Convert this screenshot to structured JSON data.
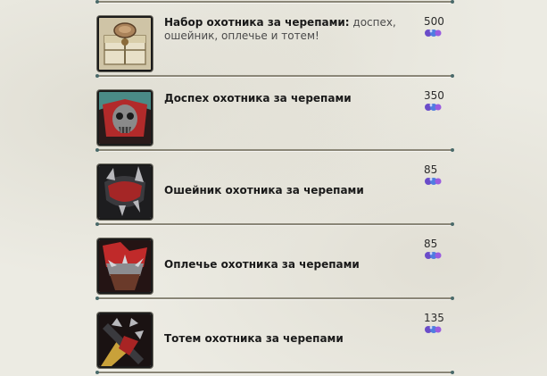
{
  "items": [
    {
      "name": "Набор охотника за черепами:",
      "desc": " доспех, ошейник, оплечье и тотем!",
      "price": "500",
      "icon": "supply-crate-icon"
    },
    {
      "name": "Доспех охотника за черепами",
      "desc": "",
      "price": "350",
      "icon": "skull-armor-icon"
    },
    {
      "name": "Ошейник охотника за черепами",
      "desc": "",
      "price": "85",
      "icon": "spiked-collar-icon"
    },
    {
      "name": "Оплечье охотника за черепами",
      "desc": "",
      "price": "85",
      "icon": "shoulder-armor-icon"
    },
    {
      "name": "Тотем охотника за черепами",
      "desc": "",
      "price": "135",
      "icon": "skull-totem-icon"
    }
  ],
  "currency_icon": "gem-cluster-icon",
  "colors": {
    "divider": "#8a8677",
    "text": "#1a1a1a",
    "background": "#ecebe3"
  }
}
